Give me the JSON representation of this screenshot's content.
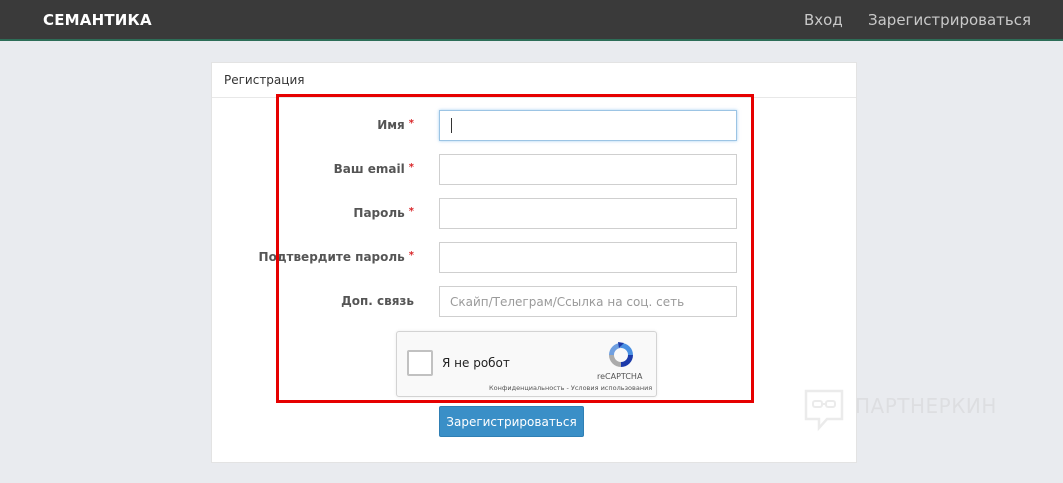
{
  "navbar": {
    "brand": "СЕМАНТИКА",
    "login_label": "Вход",
    "register_label": "Зарегистрироваться"
  },
  "panel": {
    "title": "Регистрация"
  },
  "form": {
    "fields": [
      {
        "label": "Имя",
        "required": "*",
        "value": "",
        "placeholder": ""
      },
      {
        "label": "Ваш email",
        "required": "*",
        "value": "",
        "placeholder": ""
      },
      {
        "label": "Пароль",
        "required": "*",
        "value": "",
        "placeholder": ""
      },
      {
        "label": "Подтвердите пароль",
        "required": "*",
        "value": "",
        "placeholder": ""
      },
      {
        "label": "Доп. связь",
        "required": "",
        "value": "",
        "placeholder": "Скайп/Телеграм/Ссылка на соц. сеть"
      }
    ],
    "submit_label": "Зарегистрироваться"
  },
  "recaptcha": {
    "label": "Я не робот",
    "brand": "reCAPTCHA",
    "terms": "Конфиденциальность - Условия использования"
  },
  "watermark": {
    "text": "ПАРТНЕРКИН"
  },
  "icons": {
    "recaptcha_logo": "recaptcha-logo-icon",
    "watermark_logo": "chat-bubble-icon"
  },
  "colors": {
    "navbar_bg": "#3a3a3a",
    "accent": "#3a8fc7",
    "highlight": "#e60000",
    "required": "#d9262a"
  }
}
